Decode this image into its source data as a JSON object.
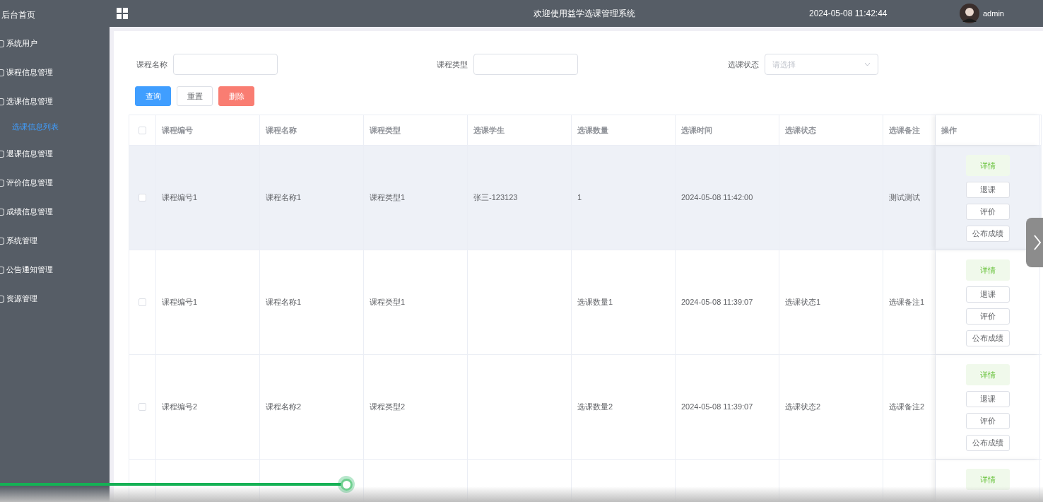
{
  "sidebar": {
    "title": "后台首页",
    "items": [
      {
        "label": "系统用户"
      },
      {
        "label": "课程信息管理"
      },
      {
        "label": "选课信息管理",
        "children": [
          {
            "label": "选课信息列表",
            "selected": true
          }
        ]
      },
      {
        "label": "退课信息管理"
      },
      {
        "label": "评价信息管理"
      },
      {
        "label": "成绩信息管理"
      },
      {
        "label": "系统管理"
      },
      {
        "label": "公告通知管理"
      },
      {
        "label": "资源管理"
      }
    ]
  },
  "header": {
    "title": "欢迎使用益学选课管理系统",
    "datetime": "2024-05-08 11:42:44",
    "user": "admin"
  },
  "filters": [
    {
      "label": "课程名称",
      "kind": "input"
    },
    {
      "label": "课程类型",
      "kind": "input"
    },
    {
      "label": "选课状态",
      "kind": "select",
      "placeholder": "请选择"
    }
  ],
  "buttons": [
    {
      "label": "查询",
      "kind": "primary"
    },
    {
      "label": "重置",
      "kind": "default"
    },
    {
      "label": "删除",
      "kind": "danger"
    }
  ],
  "table": {
    "select_all": {
      "checked": false
    },
    "columns": [
      "课程编号",
      "课程名称",
      "课程类型",
      "选课学生",
      "选课数量",
      "选课时间",
      "选课状态",
      "选课备注",
      "操作"
    ],
    "rows": [
      {
        "checked": false,
        "highlighted": true,
        "cells": [
          "课程编号1",
          "课程名称1",
          "课程类型1",
          "张三-123123",
          "1",
          "2024-05-08 11:42:00",
          null,
          "测试测试"
        ],
        "actions": [
          {
            "label": "详情",
            "kind": "success"
          },
          {
            "label": "退课",
            "kind": "default"
          },
          {
            "label": "评价",
            "kind": "default"
          },
          {
            "label": "公布成绩",
            "kind": "default"
          }
        ]
      },
      {
        "checked": false,
        "highlighted": false,
        "cells": [
          "课程编号1",
          "课程名称1",
          "课程类型1",
          null,
          "选课数量1",
          "2024-05-08 11:39:07",
          "选课状态1",
          "选课备注1"
        ],
        "actions": [
          {
            "label": "详情",
            "kind": "success"
          },
          {
            "label": "退课",
            "kind": "default"
          },
          {
            "label": "评价",
            "kind": "default"
          },
          {
            "label": "公布成绩",
            "kind": "default"
          }
        ]
      },
      {
        "checked": false,
        "highlighted": false,
        "cells": [
          "课程编号2",
          "课程名称2",
          "课程类型2",
          null,
          "选课数量2",
          "2024-05-08 11:39:07",
          "选课状态2",
          "选课备注2"
        ],
        "actions": [
          {
            "label": "详情",
            "kind": "success"
          },
          {
            "label": "退课",
            "kind": "default"
          },
          {
            "label": "评价",
            "kind": "default"
          },
          {
            "label": "公布成绩",
            "kind": "default"
          }
        ]
      },
      {
        "highlighted": false,
        "cells": [
          null,
          null,
          null,
          null,
          null,
          null,
          null,
          null
        ],
        "actions": [
          {
            "label": "详情",
            "kind": "success"
          }
        ]
      }
    ]
  },
  "video_progress": {
    "level": 0.332
  }
}
